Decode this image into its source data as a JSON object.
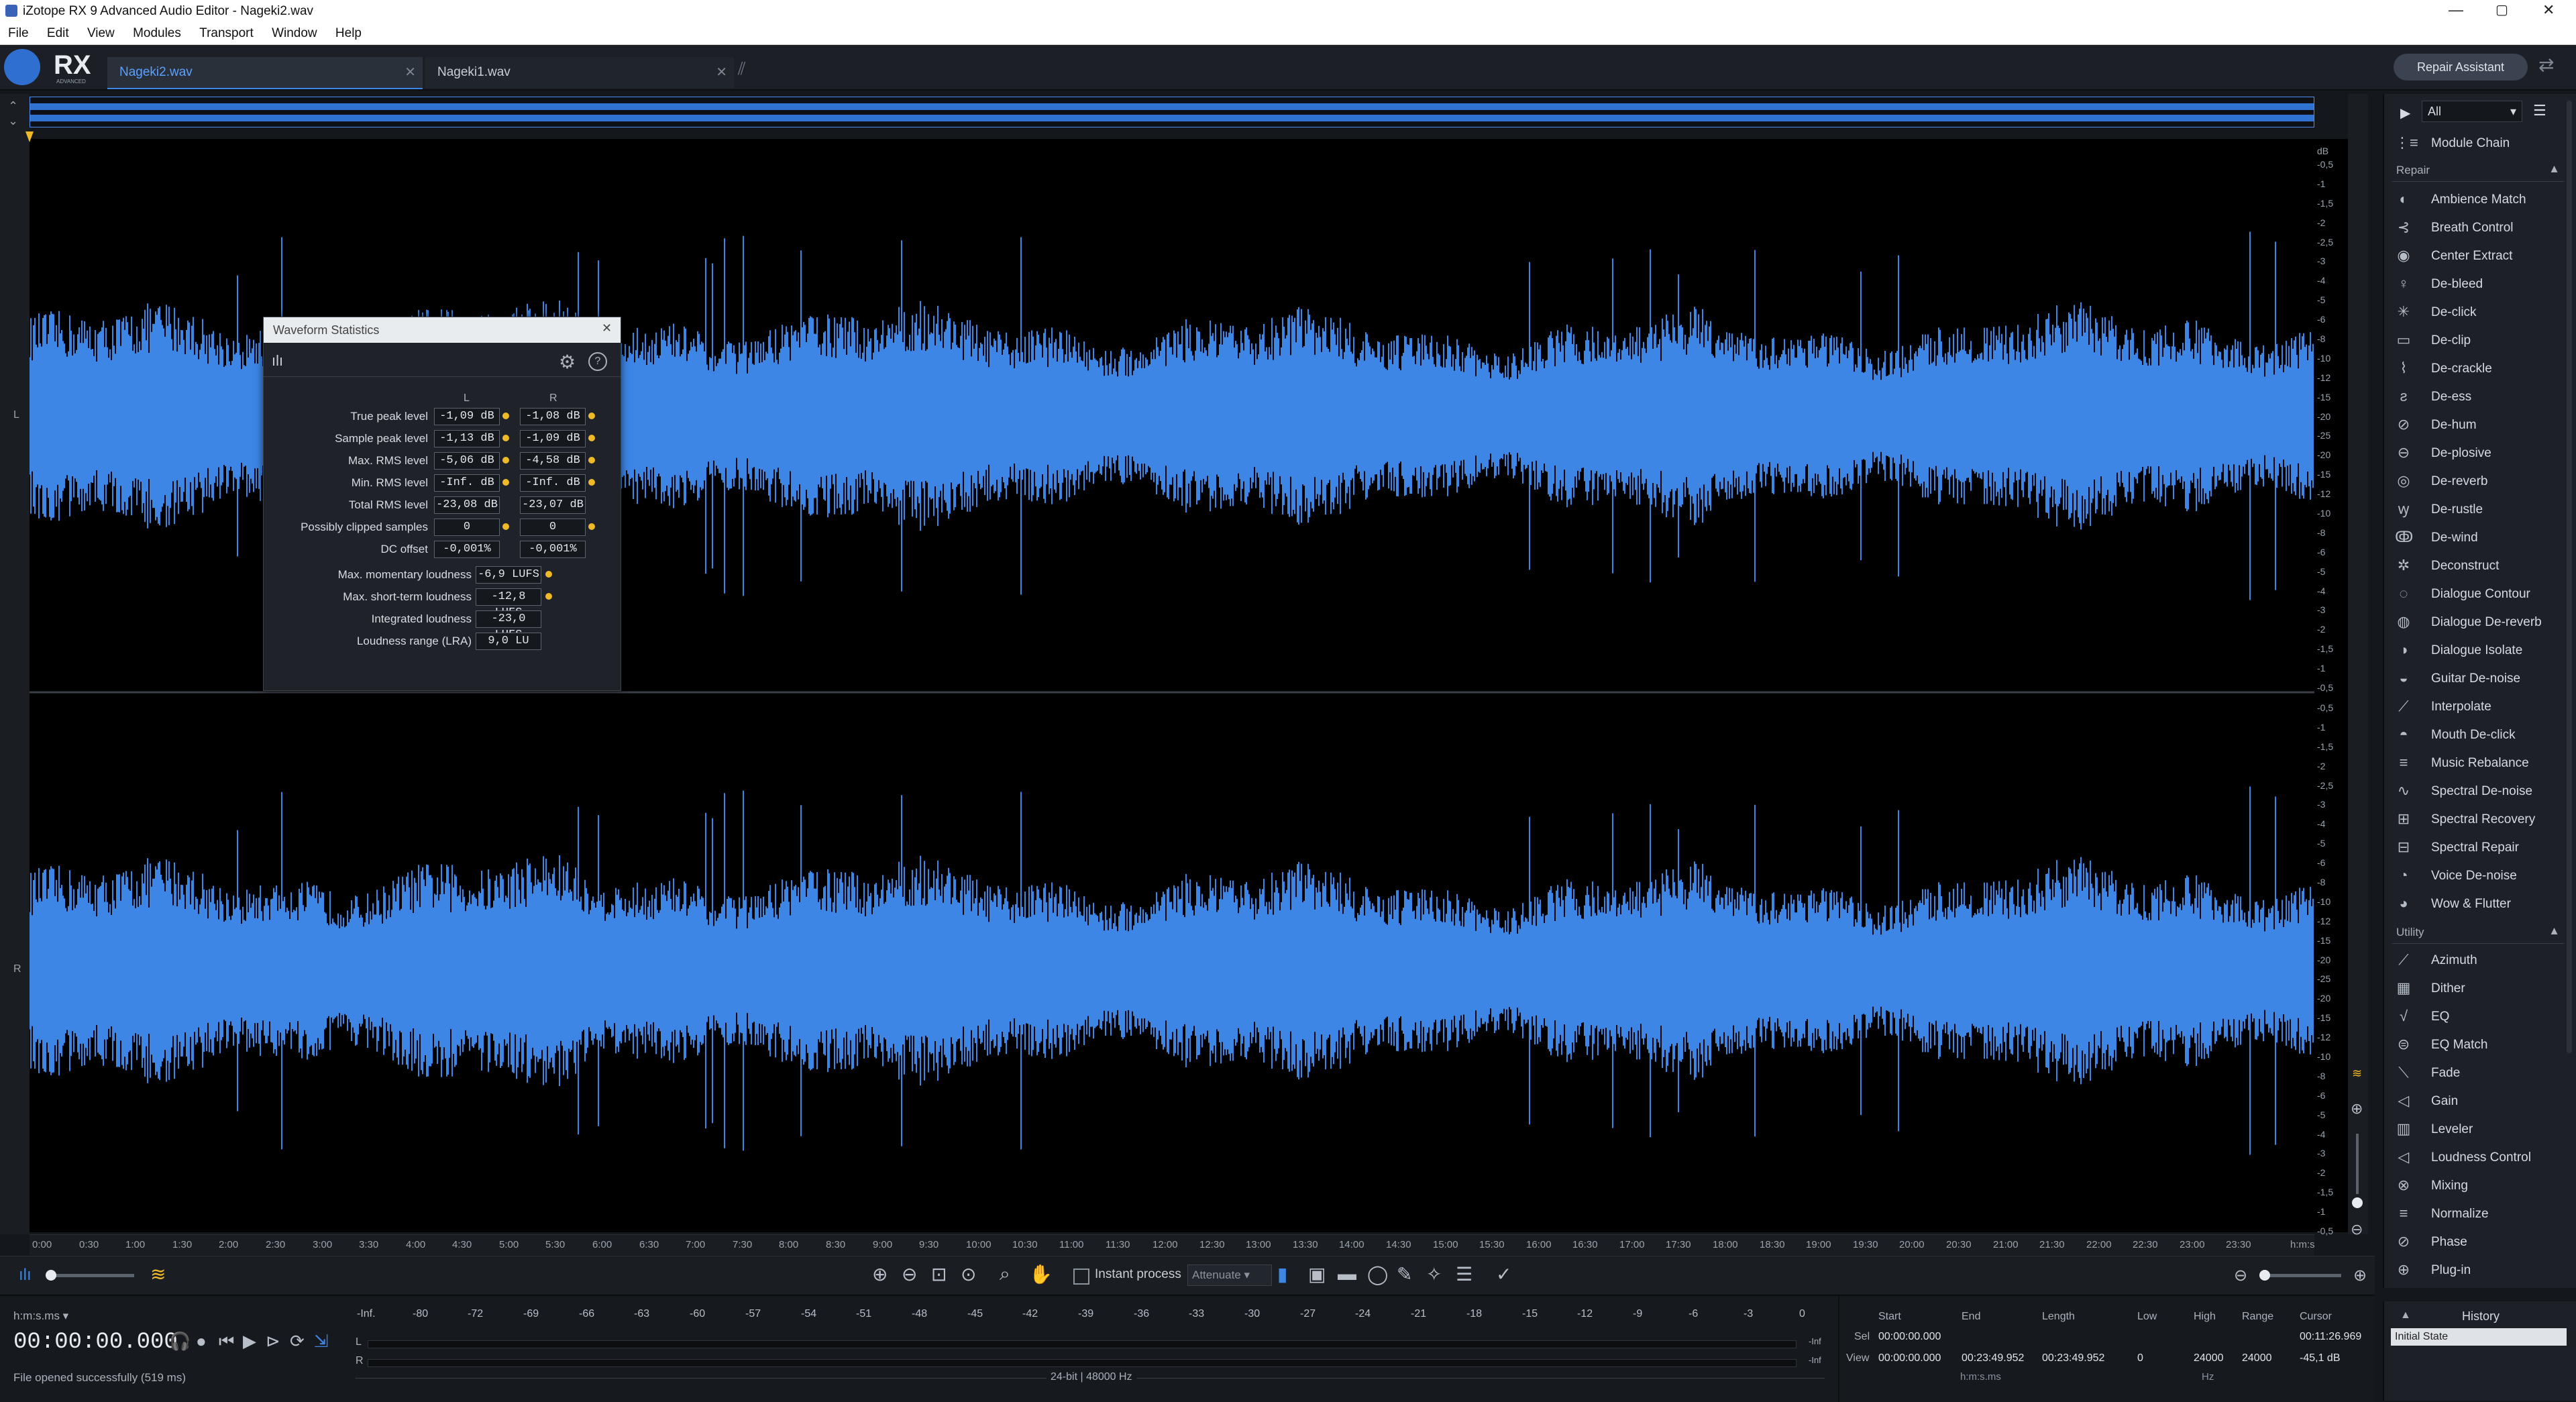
{
  "window": {
    "title": "iZotope RX 9 Advanced Audio Editor - Nageki2.wav"
  },
  "menu": [
    "File",
    "Edit",
    "View",
    "Modules",
    "Transport",
    "Window",
    "Help"
  ],
  "logo": {
    "text": "RX",
    "sub": "ADVANCED"
  },
  "tabs": [
    {
      "label": "Nageki2.wav",
      "active": true
    },
    {
      "label": "Nageki1.wav",
      "active": false
    }
  ],
  "repair_assistant": "Repair Assistant",
  "channels": {
    "left": "L",
    "right": "R"
  },
  "db_scale": {
    "unit": "dB",
    "top": [
      "-0,5",
      "-1",
      "-1,5",
      "-2",
      "-2,5",
      "-3",
      "-4",
      "-5",
      "-6",
      "-8",
      "-10",
      "-12",
      "-15",
      "-20",
      "-25",
      "-20",
      "-15",
      "-12",
      "-10",
      "-8",
      "-6",
      "-5",
      "-4",
      "-3",
      "-2",
      "-1,5",
      "-1",
      "-0,5"
    ],
    "bottom": [
      "-0,5",
      "-1",
      "-1,5",
      "-2",
      "-2,5",
      "-3",
      "-4",
      "-5",
      "-6",
      "-8",
      "-10",
      "-12",
      "-15",
      "-20",
      "-25",
      "-20",
      "-15",
      "-12",
      "-10",
      "-8",
      "-6",
      "-5",
      "-4",
      "-3",
      "-2",
      "-1,5",
      "-1",
      "-0,5"
    ]
  },
  "time_ruler": {
    "ticks": [
      "0:00",
      "0:30",
      "1:00",
      "1:30",
      "2:00",
      "2:30",
      "3:00",
      "3:30",
      "4:00",
      "4:30",
      "5:00",
      "5:30",
      "6:00",
      "6:30",
      "7:00",
      "7:30",
      "8:00",
      "8:30",
      "9:00",
      "9:30",
      "10:00",
      "10:30",
      "11:00",
      "11:30",
      "12:00",
      "12:30",
      "13:00",
      "13:30",
      "14:00",
      "14:30",
      "15:00",
      "15:30",
      "16:00",
      "16:30",
      "17:00",
      "17:30",
      "18:00",
      "18:30",
      "19:00",
      "19:30",
      "20:00",
      "20:30",
      "21:00",
      "21:30",
      "22:00",
      "22:30",
      "23:00",
      "23:30"
    ],
    "unit": "h:m:s"
  },
  "stats": {
    "title": "Waveform Statistics",
    "col_l": "L",
    "col_r": "R",
    "rows": [
      {
        "label": "True peak level",
        "l": "-1,09 dB",
        "r": "-1,08 dB",
        "dots": true
      },
      {
        "label": "Sample peak level",
        "l": "-1,13 dB",
        "r": "-1,09 dB",
        "dots": true
      },
      {
        "label": "Max. RMS level",
        "l": "-5,06 dB",
        "r": "-4,58 dB",
        "dots": true
      },
      {
        "label": "Min. RMS level",
        "l": "-Inf. dB",
        "r": "-Inf. dB",
        "dots": true
      },
      {
        "label": "Total RMS level",
        "l": "-23,08 dB",
        "r": "-23,07 dB",
        "dots": false
      },
      {
        "label": "Possibly clipped samples",
        "l": "0",
        "r": "0",
        "dots": true
      },
      {
        "label": "DC offset",
        "l": "-0,001%",
        "r": "-0,001%",
        "dots": false
      }
    ],
    "loudness": [
      {
        "label": "Max. momentary loudness",
        "v": "-6,9 LUFS",
        "dot": true
      },
      {
        "label": "Max. short-term loudness",
        "v": "-12,8 LUFS",
        "dot": true
      },
      {
        "label": "Integrated loudness",
        "v": "-23,0 LUFS",
        "dot": false
      },
      {
        "label": "Loudness range (LRA)",
        "v": "9,0 LU",
        "dot": false
      }
    ]
  },
  "toolbar": {
    "instant_process": "Instant process",
    "attenuate": "Attenuate"
  },
  "transport": {
    "format": "h:m:s.ms",
    "time": "00:00:00.000",
    "status": "File opened successfully (519 ms)"
  },
  "meter": {
    "labels": [
      "-Inf.",
      "-80",
      "-72",
      "-69",
      "-66",
      "-63",
      "-60",
      "-57",
      "-54",
      "-51",
      "-48",
      "-45",
      "-42",
      "-39",
      "-36",
      "-33",
      "-30",
      "-27",
      "-24",
      "-21",
      "-18",
      "-15",
      "-12",
      "-9",
      "-6",
      "-3",
      "0"
    ],
    "inf_l": "-Inf",
    "inf_r": "-Inf",
    "l": "L",
    "r": "R",
    "format": "24-bit | 48000 Hz"
  },
  "selection": {
    "headers": [
      "Start",
      "End",
      "Length",
      "Low",
      "High",
      "Range",
      "Cursor"
    ],
    "sel_label": "Sel",
    "view_label": "View",
    "sel_start": "00:00:00.000",
    "view_start": "00:00:00.000",
    "view_end": "00:23:49.952",
    "view_length": "00:23:49.952",
    "low": "0",
    "high": "24000",
    "range": "24000",
    "cursor_time": "00:11:26.969",
    "cursor_db": "-45,1 dB",
    "unit_time": "h:m:s.ms",
    "unit_hz": "Hz"
  },
  "modules": {
    "filter": "All",
    "chain": "Module Chain",
    "repair_section": "Repair",
    "repair": [
      "Ambience Match",
      "Breath Control",
      "Center Extract",
      "De-bleed",
      "De-click",
      "De-clip",
      "De-crackle",
      "De-ess",
      "De-hum",
      "De-plosive",
      "De-reverb",
      "De-rustle",
      "De-wind",
      "Deconstruct",
      "Dialogue Contour",
      "Dialogue De-reverb",
      "Dialogue Isolate",
      "Guitar De-noise",
      "Interpolate",
      "Mouth De-click",
      "Music Rebalance",
      "Spectral De-noise",
      "Spectral Recovery",
      "Spectral Repair",
      "Voice De-noise",
      "Wow & Flutter"
    ],
    "utility_section": "Utility",
    "utility": [
      "Azimuth",
      "Dither",
      "EQ",
      "EQ Match",
      "Fade",
      "Gain",
      "Leveler",
      "Loudness Control",
      "Mixing",
      "Normalize",
      "Phase",
      "Plug-in"
    ]
  },
  "history": {
    "title": "History",
    "items": [
      "Initial State"
    ]
  },
  "colors": {
    "waveform": "#3d86e6",
    "accent": "#1e6fd9",
    "dot": "#f0b92a"
  }
}
